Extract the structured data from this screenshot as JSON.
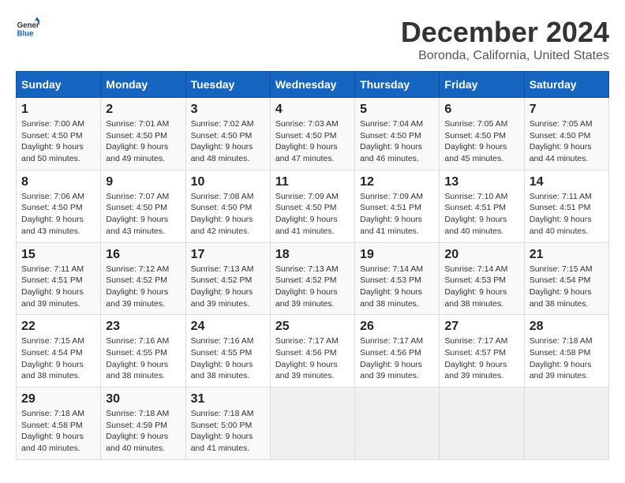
{
  "header": {
    "logo_line1": "General",
    "logo_line2": "Blue",
    "title": "December 2024",
    "subtitle": "Boronda, California, United States"
  },
  "days_of_week": [
    "Sunday",
    "Monday",
    "Tuesday",
    "Wednesday",
    "Thursday",
    "Friday",
    "Saturday"
  ],
  "weeks": [
    [
      {
        "day": "1",
        "info": "Sunrise: 7:00 AM\nSunset: 4:50 PM\nDaylight: 9 hours\nand 50 minutes."
      },
      {
        "day": "2",
        "info": "Sunrise: 7:01 AM\nSunset: 4:50 PM\nDaylight: 9 hours\nand 49 minutes."
      },
      {
        "day": "3",
        "info": "Sunrise: 7:02 AM\nSunset: 4:50 PM\nDaylight: 9 hours\nand 48 minutes."
      },
      {
        "day": "4",
        "info": "Sunrise: 7:03 AM\nSunset: 4:50 PM\nDaylight: 9 hours\nand 47 minutes."
      },
      {
        "day": "5",
        "info": "Sunrise: 7:04 AM\nSunset: 4:50 PM\nDaylight: 9 hours\nand 46 minutes."
      },
      {
        "day": "6",
        "info": "Sunrise: 7:05 AM\nSunset: 4:50 PM\nDaylight: 9 hours\nand 45 minutes."
      },
      {
        "day": "7",
        "info": "Sunrise: 7:05 AM\nSunset: 4:50 PM\nDaylight: 9 hours\nand 44 minutes."
      }
    ],
    [
      {
        "day": "8",
        "info": "Sunrise: 7:06 AM\nSunset: 4:50 PM\nDaylight: 9 hours\nand 43 minutes."
      },
      {
        "day": "9",
        "info": "Sunrise: 7:07 AM\nSunset: 4:50 PM\nDaylight: 9 hours\nand 43 minutes."
      },
      {
        "day": "10",
        "info": "Sunrise: 7:08 AM\nSunset: 4:50 PM\nDaylight: 9 hours\nand 42 minutes."
      },
      {
        "day": "11",
        "info": "Sunrise: 7:09 AM\nSunset: 4:50 PM\nDaylight: 9 hours\nand 41 minutes."
      },
      {
        "day": "12",
        "info": "Sunrise: 7:09 AM\nSunset: 4:51 PM\nDaylight: 9 hours\nand 41 minutes."
      },
      {
        "day": "13",
        "info": "Sunrise: 7:10 AM\nSunset: 4:51 PM\nDaylight: 9 hours\nand 40 minutes."
      },
      {
        "day": "14",
        "info": "Sunrise: 7:11 AM\nSunset: 4:51 PM\nDaylight: 9 hours\nand 40 minutes."
      }
    ],
    [
      {
        "day": "15",
        "info": "Sunrise: 7:11 AM\nSunset: 4:51 PM\nDaylight: 9 hours\nand 39 minutes."
      },
      {
        "day": "16",
        "info": "Sunrise: 7:12 AM\nSunset: 4:52 PM\nDaylight: 9 hours\nand 39 minutes."
      },
      {
        "day": "17",
        "info": "Sunrise: 7:13 AM\nSunset: 4:52 PM\nDaylight: 9 hours\nand 39 minutes."
      },
      {
        "day": "18",
        "info": "Sunrise: 7:13 AM\nSunset: 4:52 PM\nDaylight: 9 hours\nand 39 minutes."
      },
      {
        "day": "19",
        "info": "Sunrise: 7:14 AM\nSunset: 4:53 PM\nDaylight: 9 hours\nand 38 minutes."
      },
      {
        "day": "20",
        "info": "Sunrise: 7:14 AM\nSunset: 4:53 PM\nDaylight: 9 hours\nand 38 minutes."
      },
      {
        "day": "21",
        "info": "Sunrise: 7:15 AM\nSunset: 4:54 PM\nDaylight: 9 hours\nand 38 minutes."
      }
    ],
    [
      {
        "day": "22",
        "info": "Sunrise: 7:15 AM\nSunset: 4:54 PM\nDaylight: 9 hours\nand 38 minutes."
      },
      {
        "day": "23",
        "info": "Sunrise: 7:16 AM\nSunset: 4:55 PM\nDaylight: 9 hours\nand 38 minutes."
      },
      {
        "day": "24",
        "info": "Sunrise: 7:16 AM\nSunset: 4:55 PM\nDaylight: 9 hours\nand 38 minutes."
      },
      {
        "day": "25",
        "info": "Sunrise: 7:17 AM\nSunset: 4:56 PM\nDaylight: 9 hours\nand 39 minutes."
      },
      {
        "day": "26",
        "info": "Sunrise: 7:17 AM\nSunset: 4:56 PM\nDaylight: 9 hours\nand 39 minutes."
      },
      {
        "day": "27",
        "info": "Sunrise: 7:17 AM\nSunset: 4:57 PM\nDaylight: 9 hours\nand 39 minutes."
      },
      {
        "day": "28",
        "info": "Sunrise: 7:18 AM\nSunset: 4:58 PM\nDaylight: 9 hours\nand 39 minutes."
      }
    ],
    [
      {
        "day": "29",
        "info": "Sunrise: 7:18 AM\nSunset: 4:58 PM\nDaylight: 9 hours\nand 40 minutes."
      },
      {
        "day": "30",
        "info": "Sunrise: 7:18 AM\nSunset: 4:59 PM\nDaylight: 9 hours\nand 40 minutes."
      },
      {
        "day": "31",
        "info": "Sunrise: 7:18 AM\nSunset: 5:00 PM\nDaylight: 9 hours\nand 41 minutes."
      },
      {
        "day": "",
        "info": ""
      },
      {
        "day": "",
        "info": ""
      },
      {
        "day": "",
        "info": ""
      },
      {
        "day": "",
        "info": ""
      }
    ]
  ]
}
